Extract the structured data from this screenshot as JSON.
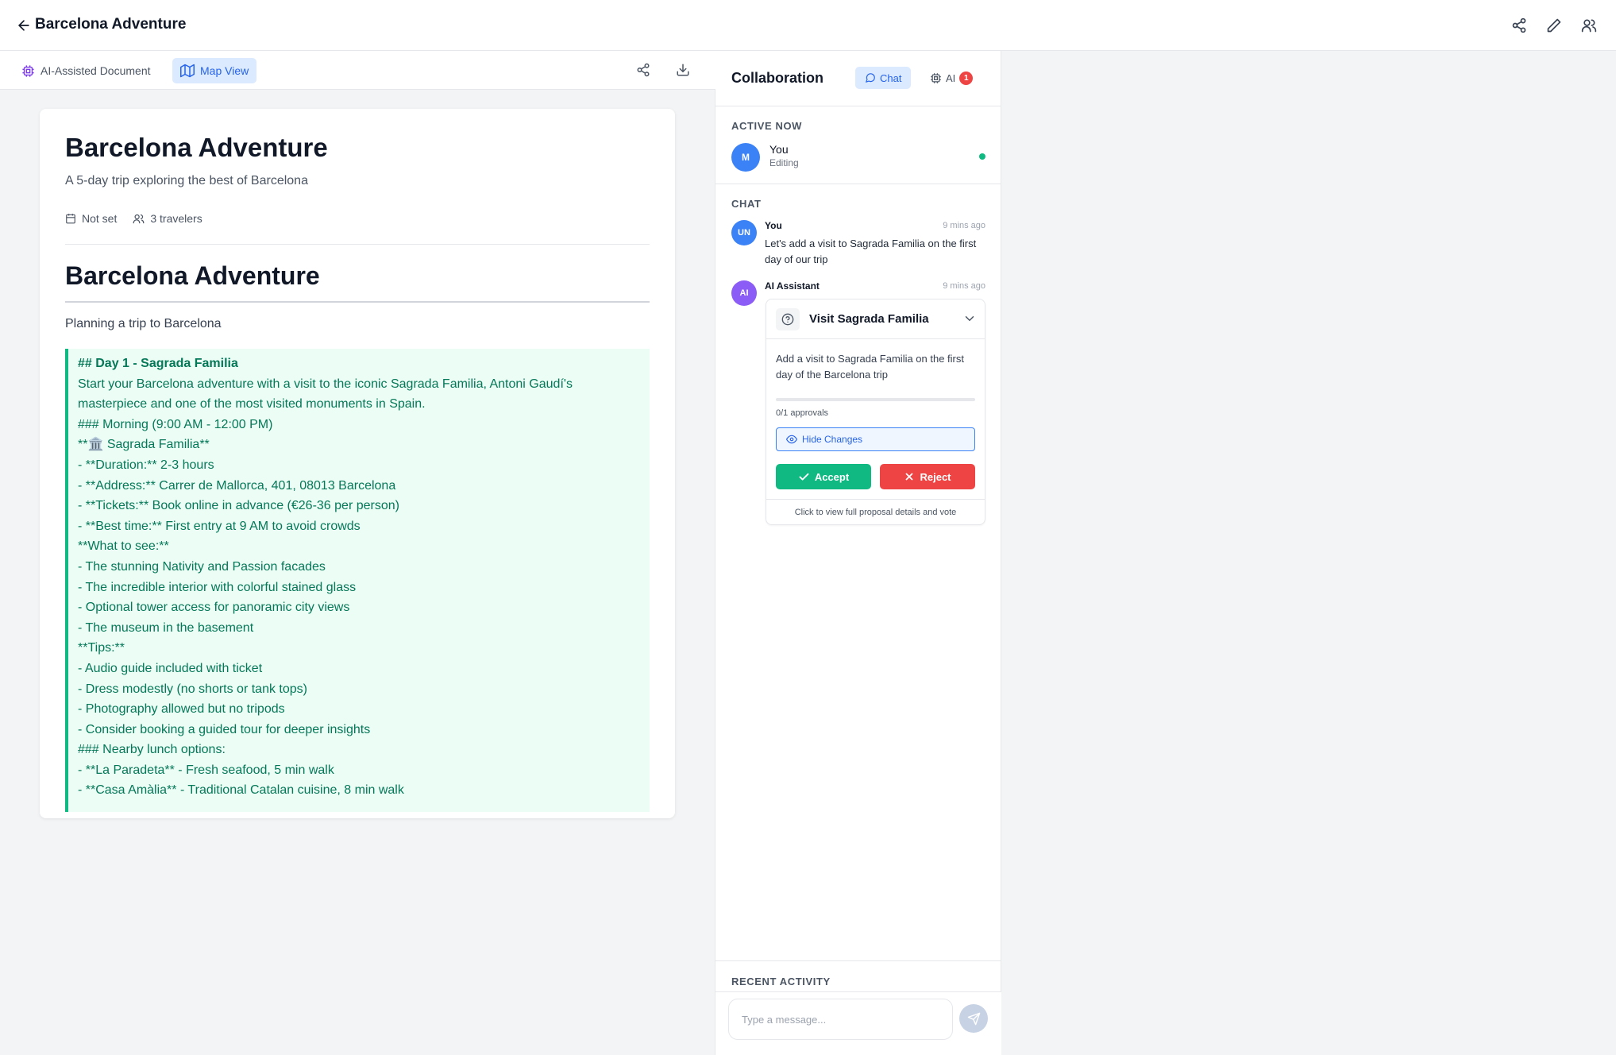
{
  "header": {
    "title": "Barcelona Adventure"
  },
  "toolbar": {
    "doc_label": "AI-Assisted Document",
    "map_label": "Map View"
  },
  "document": {
    "title": "Barcelona Adventure",
    "subtitle": "A 5-day trip exploring the best of Barcelona",
    "date": "Not set",
    "travelers": "3 travelers",
    "heading": "Barcelona Adventure",
    "intro": "Planning a trip to Barcelona",
    "proposed_lines": [
      "## Day 1 - Sagrada Familia",
      "Start your Barcelona adventure with a visit to the iconic Sagrada Familia, Antoni Gaudí's",
      "masterpiece and one of the most visited monuments in Spain.",
      "### Morning (9:00 AM - 12:00 PM)",
      "**🏛️ Sagrada Familia**",
      "- **Duration:** 2-3 hours",
      "- **Address:** Carrer de Mallorca, 401, 08013 Barcelona",
      "- **Tickets:** Book online in advance (€26-36 per person)",
      "- **Best time:** First entry at 9 AM to avoid crowds",
      "**What to see:**",
      "- The stunning Nativity and Passion facades",
      "- The incredible interior with colorful stained glass",
      "- Optional tower access for panoramic city views",
      "- The museum in the basement",
      "**Tips:**",
      "- Audio guide included with ticket",
      "- Dress modestly (no shorts or tank tops)",
      "- Photography allowed but no tripods",
      "- Consider booking a guided tour for deeper insights",
      "### Nearby lunch options:",
      "- **La Paradeta** - Fresh seafood, 5 min walk",
      "- **Casa Amàlia** - Traditional Catalan cuisine, 8 min walk"
    ]
  },
  "collab": {
    "title": "Collaboration",
    "chat_tab": "Chat",
    "ai_tab": "AI",
    "ai_badge": "1",
    "active_label": "ACTIVE NOW",
    "active_user": {
      "initials": "M",
      "name": "You",
      "status": "Editing"
    },
    "chat_label": "CHAT",
    "messages": [
      {
        "initials": "UN",
        "author": "You",
        "time": "9 mins ago",
        "text": "Let's add a visit to Sagrada Familia on the first day of our trip"
      },
      {
        "initials": "AI",
        "author": "AI Assistant",
        "time": "9 mins ago"
      }
    ],
    "proposal": {
      "title": "Visit Sagrada Familia",
      "description": "Add a visit to Sagrada Familia on the first day of the Barcelona trip",
      "approvals_text": "0/1 approvals",
      "approval_fraction": 0,
      "hide_changes": "Hide Changes",
      "accept": "Accept",
      "reject": "Reject",
      "footer": "Click to view full proposal details and vote"
    },
    "recent_label": "RECENT ACTIVITY",
    "input_placeholder": "Type a message..."
  },
  "colors": {
    "accent": "#2563eb",
    "success": "#10b981",
    "danger": "#ef4444",
    "ai_avatar": "#8b5cf6"
  }
}
